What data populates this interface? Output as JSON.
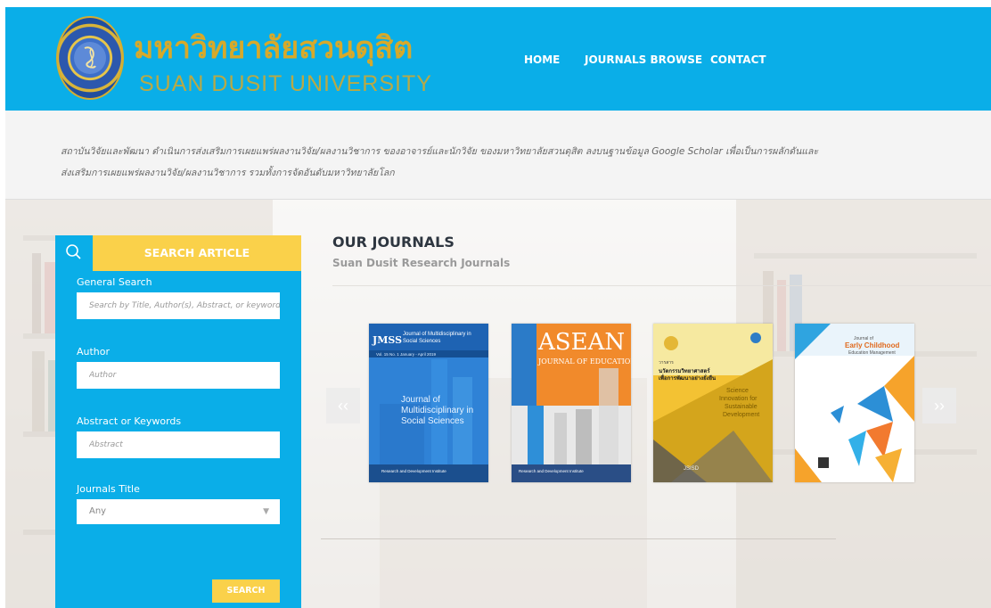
{
  "header": {
    "logo_thai": "มหาวิทยาลัยสวนดุสิต",
    "logo_en": "SUAN DUSIT UNIVERSITY",
    "nav": [
      "HOME",
      "JOURNALS BROWSE",
      "CONTACT"
    ]
  },
  "description": {
    "line1": "สถาบันวิจัยและพัฒนา ดำเนินการส่งเสริมการเผยแพร่ผลงานวิจัย/ผลงานวิชาการ ของอาจารย์และนักวิจัย ของมหาวิทยาลัยสวนดุสิต ลงบนฐานข้อมูล Google Scholar เพื่อเป็นการผลักดันและ",
    "line2": "ส่งเสริมการเผยแพร่ผลงานวิจัย/ผลงานวิชาการ รวมทั้งการจัดอันดับมหาวิทยาลัยโลก"
  },
  "search": {
    "title": "SEARCH ARTICLE",
    "general_label": "General Search",
    "general_placeholder": "Search by Title, Author(s), Abstract, or keyword",
    "author_label": "Author",
    "author_placeholder": "Author",
    "abstract_label": "Abstract or Keywords",
    "abstract_placeholder": "Abstract",
    "journal_label": "Journals Title",
    "journal_selected": "Any",
    "button": "SEARCH"
  },
  "journals": {
    "title": "OUR JOURNALS",
    "subtitle": "Suan Dusit Research Journals",
    "prev": "‹‹",
    "next": "››",
    "covers": {
      "jmss": {
        "logo": "JMSS",
        "header": "Journal of Multidisciplinary in Social Sciences",
        "issue": "Vol. 15 No. 1 January - April 2019",
        "title1": "Journal of",
        "title2": "Multidisciplinary in",
        "title3": "Social Sciences",
        "footer": "Research and Development Institute"
      },
      "asean": {
        "title": "ASEAN",
        "subtitle": "JOURNAL OF EDUCATION",
        "footer": "Research and Development Institute"
      },
      "science": {
        "thai1": "วารสาร",
        "thai2": "นวัตกรรมวิทยาศาสตร์",
        "thai3": "เพื่อการพัฒนาอย่างยั่งยืน",
        "en1": "Science",
        "en2": "Innovation for",
        "en3": "Sustainable",
        "en4": "Development",
        "issn": "JSISD"
      },
      "early": {
        "line1": "Journal of",
        "line2": "Early Childhood",
        "line3": "Education Management"
      }
    }
  },
  "colors": {
    "brand_blue": "#0aaee8",
    "accent_yellow": "#fad14a",
    "logo_gold": "#d7a92a"
  }
}
